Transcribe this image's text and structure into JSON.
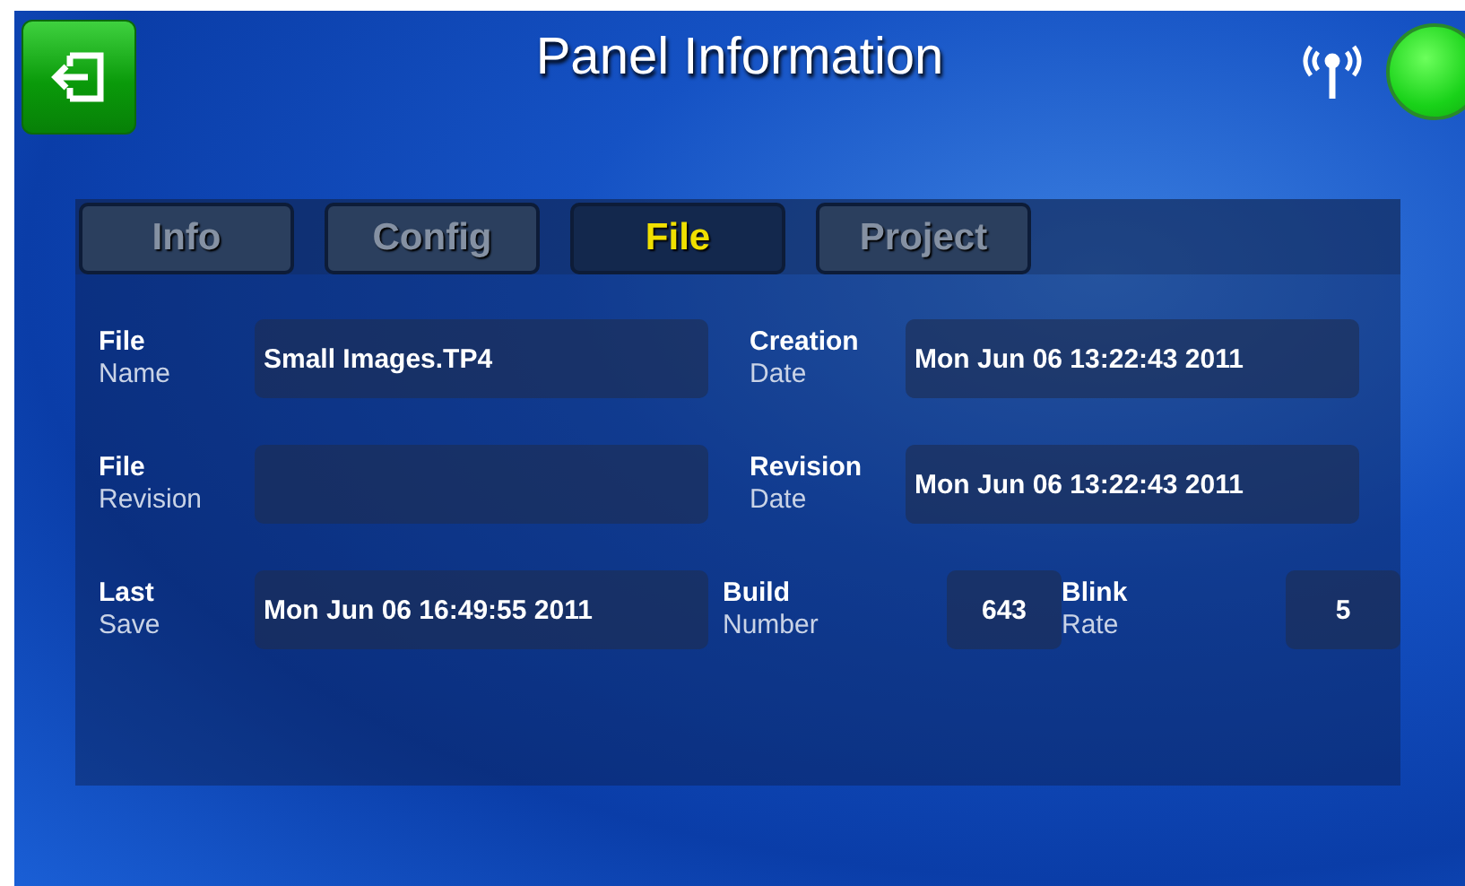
{
  "title": "Panel Information",
  "tabs": [
    {
      "label": "Info",
      "selected": false
    },
    {
      "label": "Config",
      "selected": false
    },
    {
      "label": "File",
      "selected": true
    },
    {
      "label": "Project",
      "selected": false
    }
  ],
  "rows": [
    {
      "fields": [
        {
          "kind": "wide",
          "heading": "File",
          "subheading": "Name",
          "value": "Small Images.TP4"
        },
        {
          "kind": "wide",
          "heading": "Creation",
          "subheading": "Date",
          "value": "Mon Jun 06 13:22:43 2011"
        }
      ]
    },
    {
      "fields": [
        {
          "kind": "wide",
          "heading": "File",
          "subheading": "Revision"
        },
        {
          "kind": "wide",
          "heading": "Revision",
          "subheading": "Date",
          "value": "Mon Jun 06 13:22:43 2011"
        }
      ]
    },
    {
      "fields": [
        {
          "kind": "wide",
          "heading": "Last",
          "subheading": "Save",
          "value": "Mon Jun 06 16:49:55 2011"
        },
        {
          "kind": "narrow",
          "heading": "Build",
          "subheading": "Number",
          "value": "643"
        },
        {
          "kind": "narrow",
          "heading": "Blink",
          "subheading": "Rate",
          "value": "5"
        }
      ]
    }
  ]
}
